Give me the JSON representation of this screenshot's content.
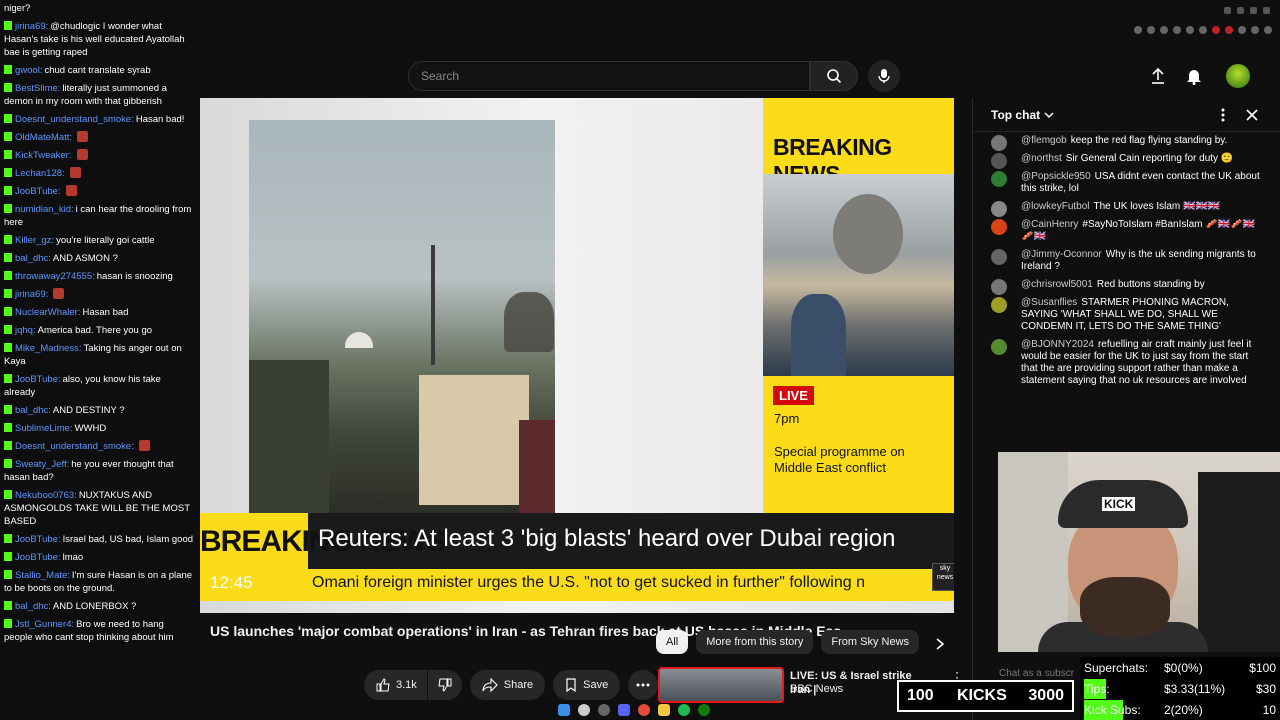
{
  "youtube": {
    "search_placeholder": "Search"
  },
  "video": {
    "side_panel": {
      "heading": "BREAKING NEWS",
      "live": "LIVE",
      "time": "7pm",
      "programme": "Special programme on Middle East conflict"
    },
    "lower_third": {
      "bn_label": "BREAKING NEWS",
      "headline": "Reuters: At least 3 'big blasts' heard over Dubai region",
      "clock": "12:45",
      "ticker": "Omani foreign minister urges the U.S. \"not to get sucked in further\" following n"
    },
    "corner_logo": "sky news"
  },
  "video_info": {
    "title": "US launches 'major combat operations' in Iran - as Tehran fires back at US bases in Middle East",
    "likes": "3.1k",
    "share_label": "Share",
    "save_label": "Save"
  },
  "chips": [
    "All",
    "More from this story",
    "From Sky News"
  ],
  "recommended": {
    "title": "LIVE: US & Israel strike Iran |",
    "channel": "BBC News"
  },
  "top_chat": {
    "header": "Top chat",
    "input_placeholder": "Chat as a subscr",
    "messages": [
      {
        "user": "@flemgob",
        "text": "keep the red flag flying standing by."
      },
      {
        "user": "@northst",
        "text": "Sir General Cain reporting for duty 🙂"
      },
      {
        "user": "@Popsickle950",
        "text": "USA didnt even contact the UK about this strike, lol"
      },
      {
        "user": "@lowkeyFutbol",
        "text": "The UK loves Islam 🇬🇧🇬🇧🇬🇧"
      },
      {
        "user": "@CainHenry",
        "text": "#SayNoToIslam #BanIslam 🥓🇬🇧🥓🇬🇧🥓🇬🇧"
      },
      {
        "user": "@Jimmy-Oconnor",
        "text": "Why is the uk sending migrants to Ireland ?"
      },
      {
        "user": "@chrisrowl5001",
        "text": "Red buttons standing by"
      },
      {
        "user": "@Susanflies",
        "text": "STARMER PHONING MACRON, SAYING 'WHAT SHALL WE DO, SHALL WE CONDEMN IT, LETS DO THE SAME THING'"
      },
      {
        "user": "@BJONNY2024",
        "text": "refuelling air craft mainly just feel it would be easier for the UK to just say from the start that the are providing support rather than make a statement saying that no uk resources are involved"
      }
    ]
  },
  "webcam": {
    "cap_text": "KICK"
  },
  "stats": {
    "rows": [
      {
        "label": "Superchats:",
        "value": "$0(0%)",
        "goal": "$100",
        "fill": 0
      },
      {
        "label": "Tips:",
        "value": "$3.33(11%)",
        "goal": "$30",
        "fill": 0.11
      },
      {
        "label": "Kick Subs:",
        "value": "2(20%)",
        "goal": "10",
        "fill": 0.2
      }
    ],
    "kicks_left": "100",
    "kicks_label": "KICKS",
    "kicks_right": "3000"
  },
  "left_chat": {
    "messages": [
      {
        "user": "",
        "text": "niger?"
      },
      {
        "user": "jirina69:",
        "text": "@chudlogic I wonder what Hasan's take is his well educated Ayatollah bae is getting raped"
      },
      {
        "user": "gwool:",
        "text": "chud cant translate syrab"
      },
      {
        "user": "BestSlime:",
        "text": "literally just summoned a demon in my room with that gibberish"
      },
      {
        "user": "Doesnt_understand_smoke:",
        "text": "Hasan bad!"
      },
      {
        "user": "OldMateMatt:",
        "text": ""
      },
      {
        "user": "KickTweaker:",
        "text": ""
      },
      {
        "user": "Lechan128:",
        "text": ""
      },
      {
        "user": "JooBTube:",
        "text": ""
      },
      {
        "user": "numidian_kid:",
        "text": "i can hear the drooling from here"
      },
      {
        "user": "Killer_gz:",
        "text": "you're literally goi cattle"
      },
      {
        "user": "bal_dhc:",
        "text": "AND ASMON ?"
      },
      {
        "user": "throwaway274555:",
        "text": "hasan is snoozing"
      },
      {
        "user": "jirina69:",
        "text": ""
      },
      {
        "user": "NuclearWhaler:",
        "text": "Hasan bad"
      },
      {
        "user": "jqhq:",
        "text": "America bad. There you go"
      },
      {
        "user": "Mike_Madness:",
        "text": "Taking his anger out on Kaya"
      },
      {
        "user": "JooBTube:",
        "text": "also, you know his take already"
      },
      {
        "user": "bal_dhc:",
        "text": "AND DESTINY ?"
      },
      {
        "user": "SublimeLime:",
        "text": "WWHD"
      },
      {
        "user": "Doesnt_understand_smoke:",
        "text": ""
      },
      {
        "user": "Sweaty_Jeff:",
        "text": "he you ever thought that hasan bad?"
      },
      {
        "user": "Nekuboo0763:",
        "text": "NUXTAKUS AND ASMONGOLDS TAKE WILL BE THE MOST BASED"
      },
      {
        "user": "JooBTube:",
        "text": "Israel bad, US bad, Islam good"
      },
      {
        "user": "JooBTube:",
        "text": "lmao"
      },
      {
        "user": "Stallio_Mate:",
        "text": "I'm sure Hasan is on a plane to be boots on the ground."
      },
      {
        "user": "bal_dhc:",
        "text": "AND LONERBOX ?"
      },
      {
        "user": "Jstl_Gunner4:",
        "text": "Bro we need to hang people who cant stop thinking about him"
      }
    ]
  }
}
